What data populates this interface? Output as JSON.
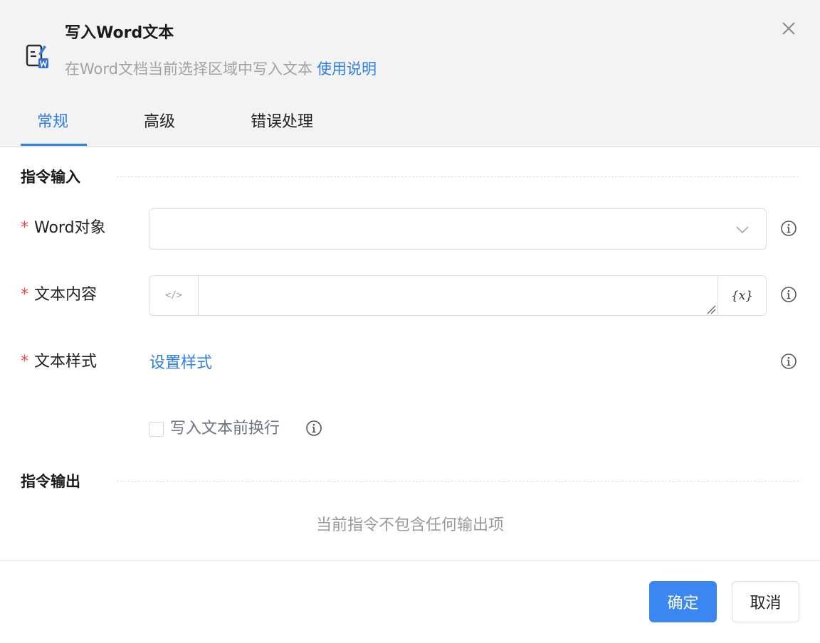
{
  "dialog": {
    "title": "写入Word文本",
    "subtitle": "在Word文档当前选择区域中写入文本",
    "help_link": "使用说明",
    "icon": "word-write-icon",
    "close_icon": "close-icon"
  },
  "tabs": [
    {
      "label": "常规",
      "active": true
    },
    {
      "label": "高级",
      "active": false
    },
    {
      "label": "错误处理",
      "active": false
    }
  ],
  "input_section": {
    "title": "指令输入",
    "fields": {
      "word_object": {
        "required_mark": "*",
        "label": "Word对象",
        "value": "",
        "icon": "chevron-down-icon"
      },
      "text_content": {
        "required_mark": "*",
        "label": "文本内容",
        "value": "",
        "code_button": "</>",
        "var_button": "{x}"
      },
      "text_style": {
        "required_mark": "*",
        "label": "文本样式",
        "link": "设置样式"
      },
      "newline_before": {
        "label": "写入文本前换行",
        "checked": false
      }
    }
  },
  "output_section": {
    "title": "指令输出",
    "empty_text": "当前指令不包含任何输出项"
  },
  "footer": {
    "ok_label": "确定",
    "cancel_label": "取消"
  },
  "colors": {
    "accent": "#2f7fe6",
    "primary_button": "#3b86f0",
    "required": "#ef4b4b",
    "header_bg": "#f3f3f3"
  }
}
